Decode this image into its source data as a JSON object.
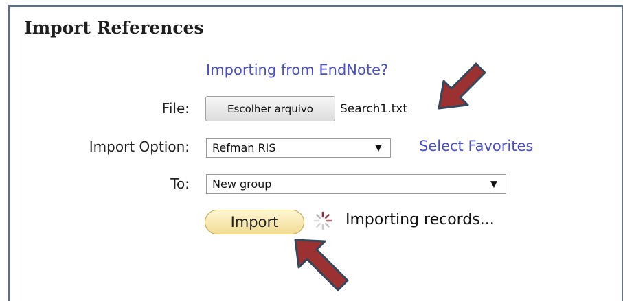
{
  "panel": {
    "title": "Import References",
    "endnote_link": "Importing from EndNote?"
  },
  "form": {
    "file": {
      "label": "File:",
      "button_label": "Escolher arquivo",
      "file_name": "Search1.txt"
    },
    "import_option": {
      "label": "Import Option:",
      "selected": "Refman RIS",
      "favorites_link": "Select Favorites"
    },
    "to": {
      "label": "To:",
      "selected": "New group"
    },
    "import_button": "Import",
    "status": "Importing records..."
  },
  "icons": {
    "spinner": "loading-spinner-icon",
    "select_arrow": "triangle-down-icon",
    "annotation_arrow": "annotation-arrow-icon"
  },
  "colors": {
    "link": "#4a4fc4",
    "frame_border": "#5e6e80",
    "import_button": "#f1dc95",
    "annotation_arrow_fill": "#9b3130",
    "annotation_arrow_stroke": "#33485c",
    "spinner": "#8a2a3a"
  }
}
